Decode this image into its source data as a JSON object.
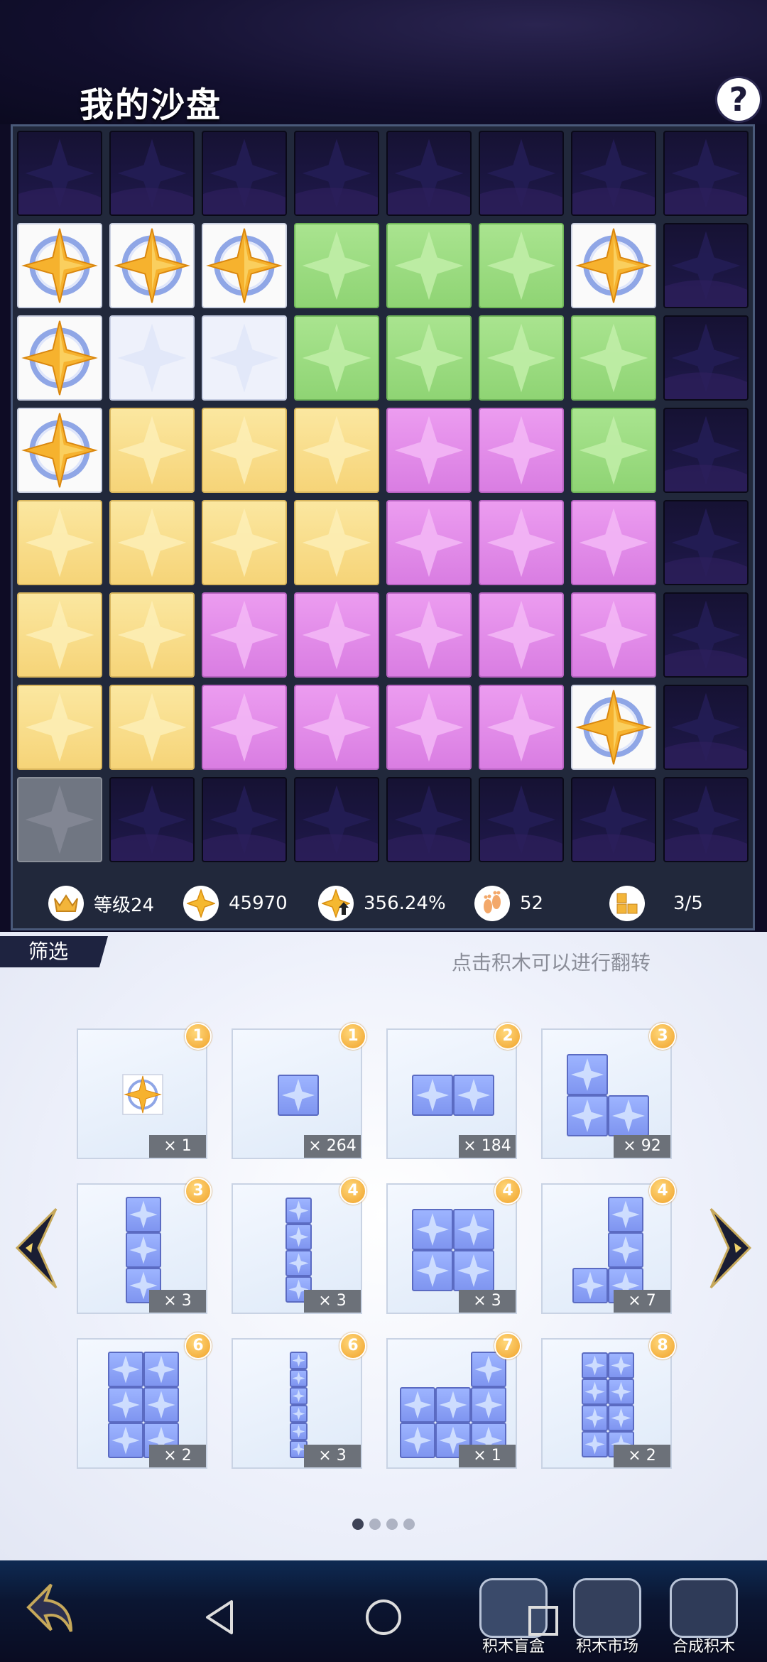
{
  "header": {
    "title": "我的沙盘",
    "help_label": "?"
  },
  "board": {
    "rows": [
      [
        "empty",
        "empty",
        "empty",
        "empty",
        "empty",
        "empty",
        "empty",
        "empty"
      ],
      [
        "gold",
        "gold",
        "gold",
        "green",
        "green",
        "green",
        "gold",
        "empty"
      ],
      [
        "gold",
        "white",
        "white",
        "green",
        "green",
        "green",
        "green",
        "empty"
      ],
      [
        "gold",
        "yellow",
        "yellow",
        "yellow",
        "pink",
        "pink",
        "green",
        "empty"
      ],
      [
        "yellow",
        "yellow",
        "yellow",
        "yellow",
        "pink",
        "pink",
        "pink",
        "empty"
      ],
      [
        "yellow",
        "yellow",
        "pink",
        "pink",
        "pink",
        "pink",
        "pink",
        "empty"
      ],
      [
        "yellow",
        "yellow",
        "pink",
        "pink",
        "pink",
        "pink",
        "gold",
        "empty"
      ],
      [
        "gray",
        "empty",
        "empty",
        "empty",
        "empty",
        "empty",
        "empty",
        "empty"
      ]
    ]
  },
  "stats": {
    "level": "等级24",
    "stars": "45970",
    "bonus": "356.24%",
    "steps": "52",
    "blocks": "3/5",
    "icons": [
      "crown-icon",
      "star-icon",
      "star-up-icon",
      "footprint-icon",
      "blocks-icon"
    ]
  },
  "panel": {
    "filter_label": "筛选",
    "hint": "点击积木可以进行翻转",
    "pages": 4,
    "current_page": 1
  },
  "cards": [
    {
      "badge": "1",
      "count": "× 1",
      "shape": "gold"
    },
    {
      "badge": "1",
      "count": "× 264",
      "shape": "single"
    },
    {
      "badge": "2",
      "count": "× 184",
      "shape": "domino"
    },
    {
      "badge": "3",
      "count": "× 92",
      "shape": "L3"
    },
    {
      "badge": "3",
      "count": "× 3",
      "shape": "I3"
    },
    {
      "badge": "4",
      "count": "× 3",
      "shape": "I4"
    },
    {
      "badge": "4",
      "count": "× 3",
      "shape": "O4"
    },
    {
      "badge": "4",
      "count": "× 7",
      "shape": "J4"
    },
    {
      "badge": "6",
      "count": "× 2",
      "shape": "R6"
    },
    {
      "badge": "6",
      "count": "× 3",
      "shape": "I6"
    },
    {
      "badge": "7",
      "count": "× 1",
      "shape": "L7"
    },
    {
      "badge": "8",
      "count": "× 2",
      "shape": "R8"
    }
  ],
  "bottom": {
    "items": [
      {
        "label": "积木盲盒",
        "icon": "mystery-box-icon"
      },
      {
        "label": "积木市场",
        "icon": "cart-icon"
      },
      {
        "label": "合成积木",
        "icon": "compose-icon"
      }
    ]
  }
}
